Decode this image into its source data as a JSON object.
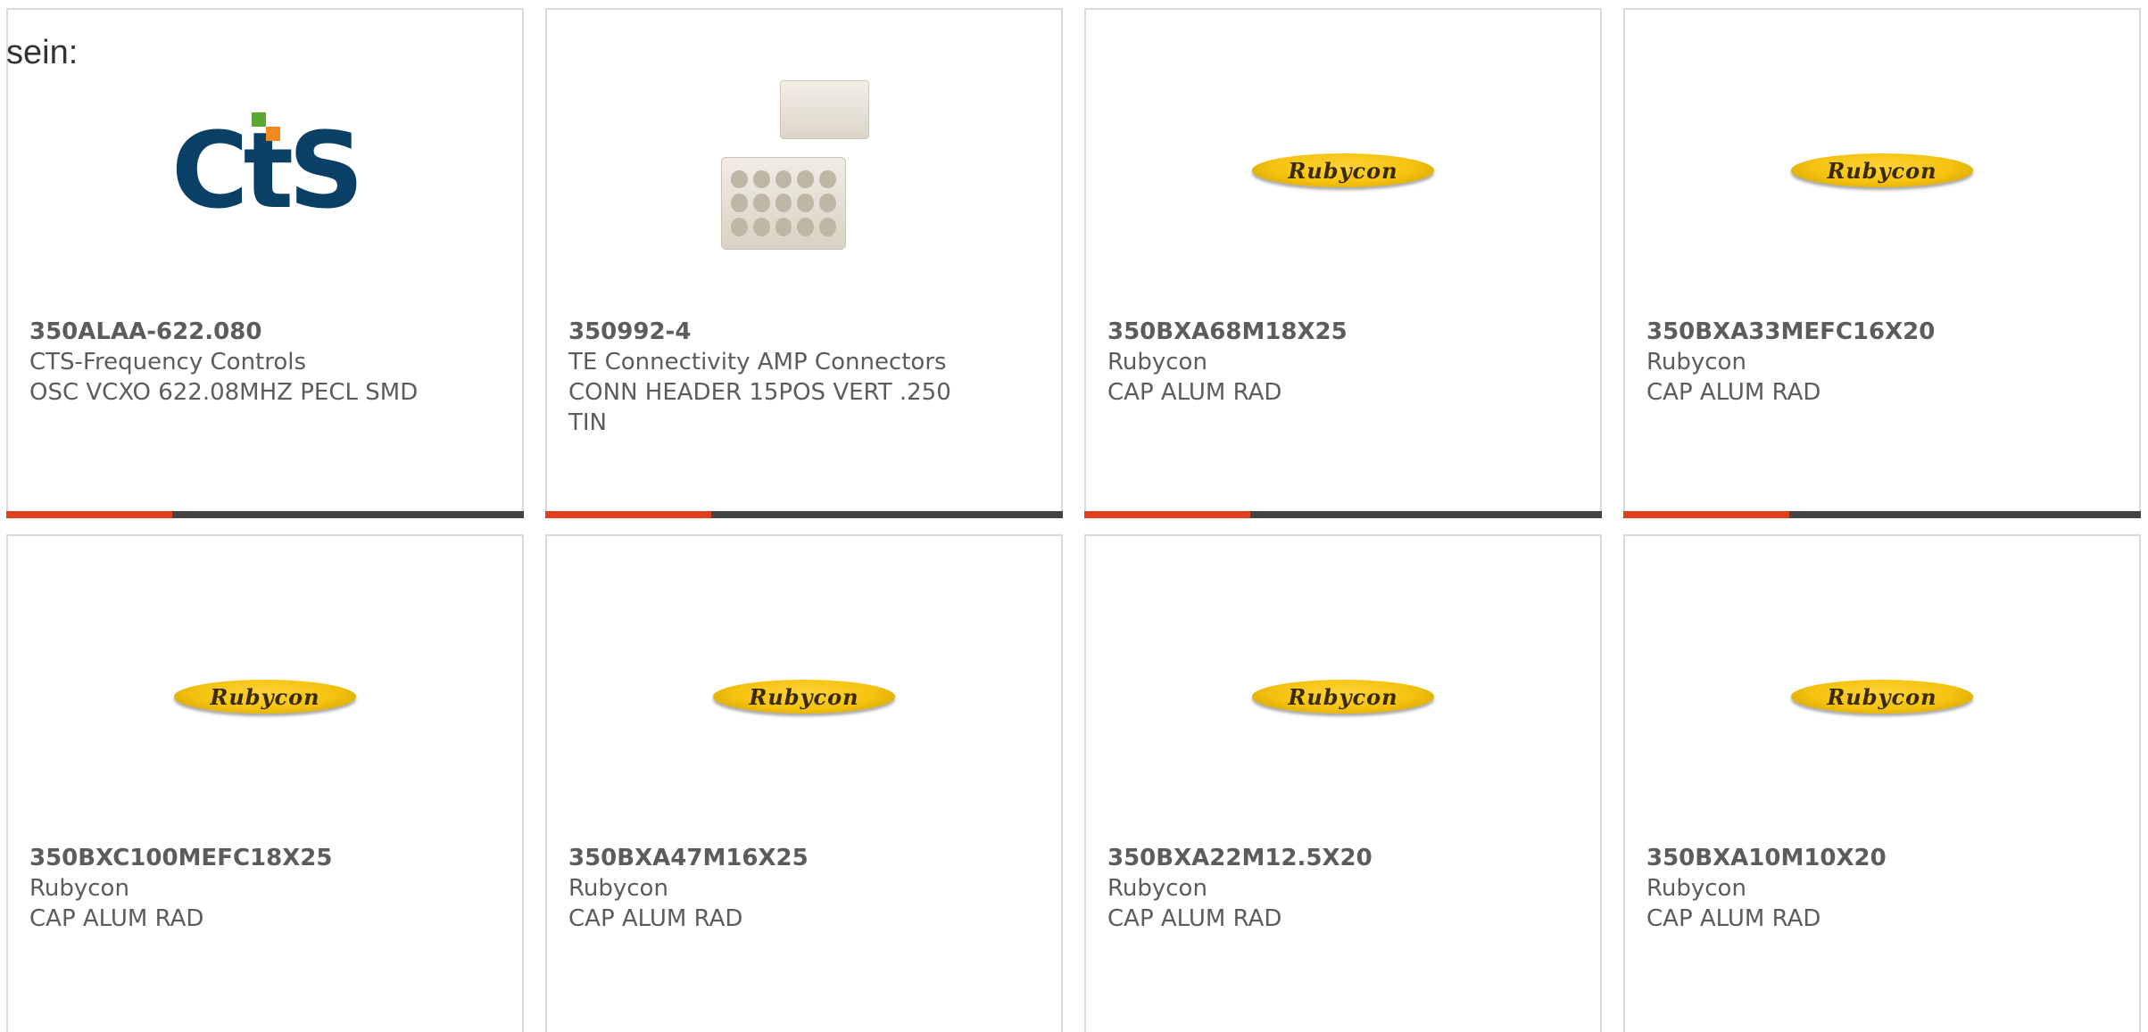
{
  "intro_text": "sein:",
  "colors": {
    "accent_fill": "#e0401b",
    "bar_track": "#444444",
    "text": "#5c5c5c",
    "border": "#dadada"
  },
  "cards": [
    {
      "part_number": "350ALAA-622.080",
      "manufacturer": "CTS-Frequency Controls",
      "description": "OSC VCXO 622.08MHZ PECL SMD",
      "image": "cts-logo",
      "progress": 0.32
    },
    {
      "part_number": "350992-4",
      "manufacturer": "TE Connectivity AMP Connectors",
      "description": "CONN HEADER 15POS VERT .250 TIN",
      "image": "connector-photo",
      "progress": 0.32
    },
    {
      "part_number": "350BXA68M18X25",
      "manufacturer": "Rubycon",
      "description": "CAP ALUM RAD",
      "image": "rubycon-logo",
      "logo_text": "Rubycon",
      "progress": 0.32
    },
    {
      "part_number": "350BXA33MEFC16X20",
      "manufacturer": "Rubycon",
      "description": "CAP ALUM RAD",
      "image": "rubycon-logo",
      "logo_text": "Rubycon",
      "progress": 0.32
    },
    {
      "part_number": "350BXC100MEFC18X25",
      "manufacturer": "Rubycon",
      "description": "CAP ALUM RAD",
      "image": "rubycon-logo",
      "logo_text": "Rubycon"
    },
    {
      "part_number": "350BXA47M16X25",
      "manufacturer": "Rubycon",
      "description": "CAP ALUM RAD",
      "image": "rubycon-logo",
      "logo_text": "Rubycon"
    },
    {
      "part_number": "350BXA22M12.5X20",
      "manufacturer": "Rubycon",
      "description": "CAP ALUM RAD",
      "image": "rubycon-logo",
      "logo_text": "Rubycon"
    },
    {
      "part_number": "350BXA10M10X20",
      "manufacturer": "Rubycon",
      "description": "CAP ALUM RAD",
      "image": "rubycon-logo",
      "logo_text": "Rubycon"
    }
  ],
  "cts_logo_text": "CtS"
}
